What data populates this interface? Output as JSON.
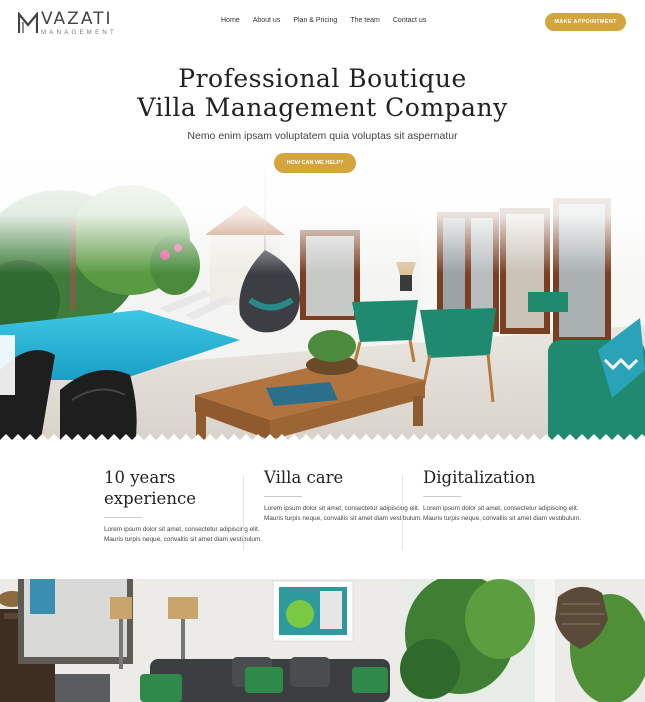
{
  "header": {
    "logo": {
      "name": "VAZATI",
      "sub": "MANAGEMENT"
    },
    "nav": [
      "Home",
      "About us",
      "Plan & Pricing",
      "The team",
      "Contact us"
    ],
    "cta": "MAKE APPOINTMENT"
  },
  "hero": {
    "title_line1": "Professional Boutique",
    "title_line2": "Villa Management Company",
    "subtitle": "Nemo enim ipsam voluptatem quia voluptas sit aspernatur",
    "cta": "HOW CAN WE HELP?"
  },
  "features": [
    {
      "title_line1": "10 years",
      "title_line2": "experience",
      "text": "Lorem ipsum dolor sit amet, consectetur adipiscing elit. Mauris turpis neque, convallis sit amet diam vestibulum."
    },
    {
      "title_line1": "Villa care",
      "title_line2": "",
      "text": "Lorem ipsum dolor sit amet, consectetur adipiscing elit. Mauris turpis neque, convallis sit amet diam vestibulum."
    },
    {
      "title_line1": "Digitalization",
      "title_line2": "",
      "text": "Lorem ipsum dolor sit amet, consectetur adipiscing elit. Mauris turpis neque, convallis sit amet diam vestibulum."
    }
  ],
  "colors": {
    "accent": "#d4a53c",
    "pool": "#2bb6d6",
    "chair": "#1f8a70"
  }
}
